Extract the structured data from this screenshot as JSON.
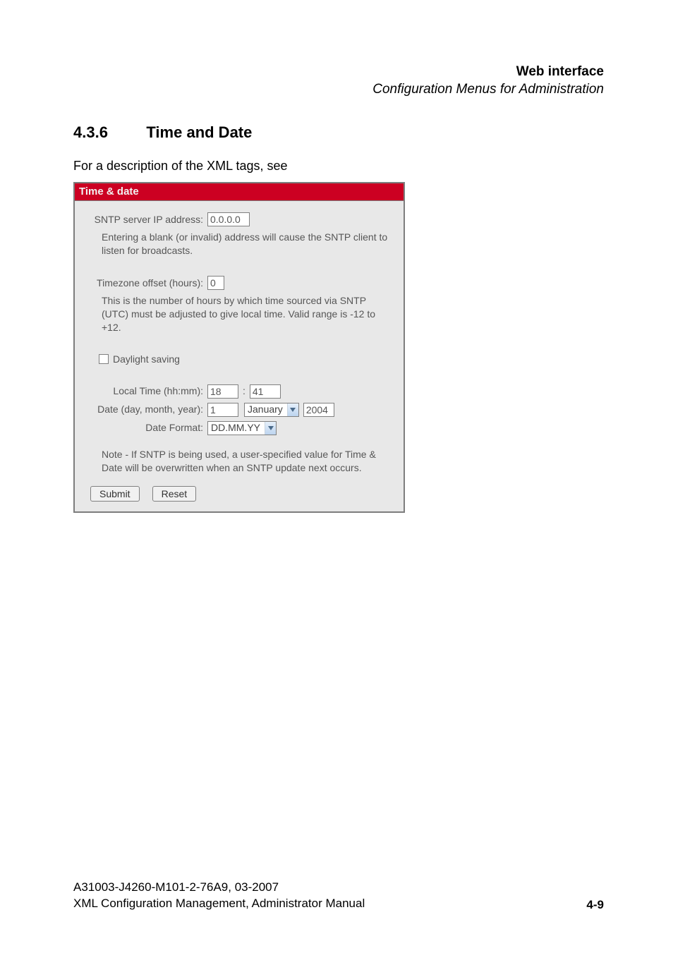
{
  "header": {
    "title": "Web interface",
    "subtitle": "Configuration Menus for Administration"
  },
  "section": {
    "number": "4.3.6",
    "title": "Time and Date"
  },
  "intro": "For a description of the XML tags, see",
  "panel": {
    "title": "Time & date",
    "sntp": {
      "label": "SNTP server IP address:",
      "value": "0.0.0.0",
      "help": "Entering a blank (or invalid) address will cause the SNTP client to listen for broadcasts."
    },
    "tz": {
      "label": "Timezone offset (hours):",
      "value": "0",
      "help": "This is the number of hours by which time sourced via SNTP (UTC) must be adjusted to give local time. Valid range is -12 to +12."
    },
    "daylight": {
      "label": "Daylight saving"
    },
    "localtime": {
      "label": "Local Time (hh:mm):",
      "hh": "18",
      "sep": ":",
      "mm": "41"
    },
    "date": {
      "label": "Date (day, month, year):",
      "day": "1",
      "month": "January",
      "year": "2004"
    },
    "dateformat": {
      "label": "Date Format:",
      "value": "DD.MM.YY"
    },
    "note": "Note - If SNTP is being used, a user-specified value for Time & Date will be overwritten when an SNTP update next occurs.",
    "buttons": {
      "submit": "Submit",
      "reset": "Reset"
    }
  },
  "footer": {
    "line1": "A31003-J4260-M101-2-76A9, 03-2007",
    "line2": "XML Configuration Management, Administrator Manual",
    "page": "4-9"
  }
}
